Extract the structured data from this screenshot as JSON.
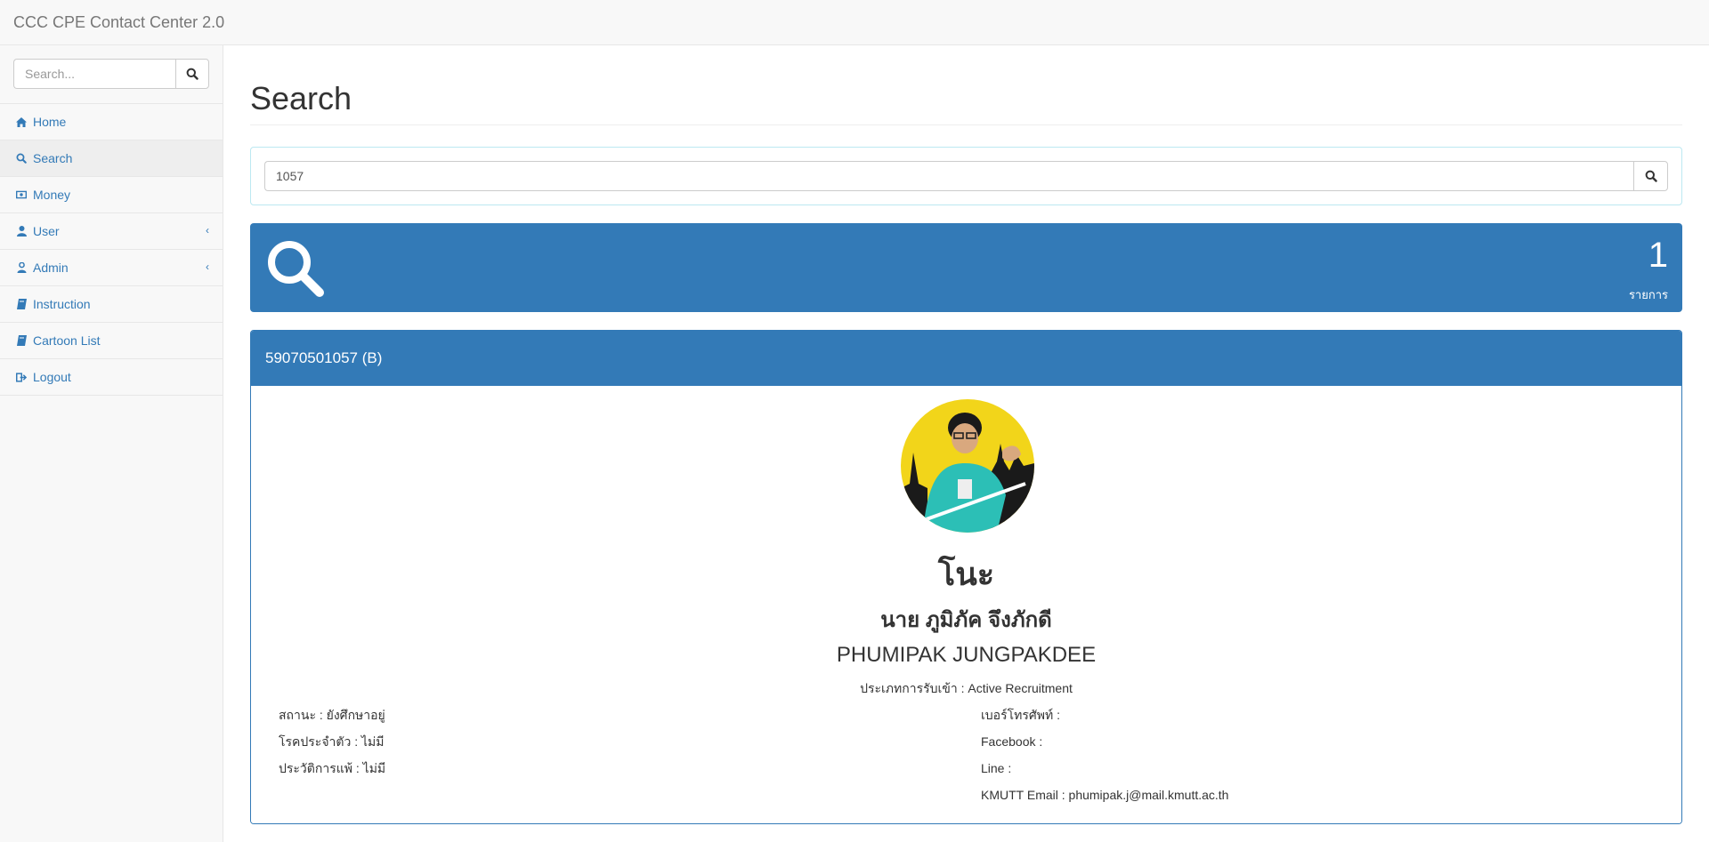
{
  "navbar": {
    "brand": "CCC  CPE Contact Center 2.0"
  },
  "sidebar": {
    "search_placeholder": "Search...",
    "items": [
      {
        "label": "Home",
        "icon": "home-icon"
      },
      {
        "label": "Search",
        "icon": "search-icon",
        "active": true
      },
      {
        "label": "Money",
        "icon": "money-icon"
      },
      {
        "label": "User",
        "icon": "user-icon",
        "chevron": "‹"
      },
      {
        "label": "Admin",
        "icon": "admin-icon",
        "chevron": "‹"
      },
      {
        "label": "Instruction",
        "icon": "book-icon"
      },
      {
        "label": "Cartoon List",
        "icon": "book-icon"
      },
      {
        "label": "Logout",
        "icon": "sign-out-icon"
      }
    ]
  },
  "main": {
    "title": "Search",
    "search_value": "1057",
    "count": "1",
    "count_label": "รายการ",
    "result": {
      "header": "59070501057 (B)",
      "nickname": "โนะ",
      "thai_name": "นาย ภูมิภัค จึงภักดี",
      "english_name": "PHUMIPAK JUNGPAKDEE",
      "admission": "ประเภทการรับเข้า : Active Recruitment",
      "left_info": [
        "สถานะ : ยังศึกษาอยู่",
        "โรคประจำตัว : ไม่มี",
        "ประวัติการแพ้ : ไม่มี"
      ],
      "right_info": [
        "เบอร์โทรศัพท์ :",
        "Facebook :",
        "Line :",
        "KMUTT Email : phumipak.j@mail.kmutt.ac.th"
      ]
    }
  },
  "colors": {
    "primary": "#337ab7",
    "well_border": "#bce8f1"
  }
}
